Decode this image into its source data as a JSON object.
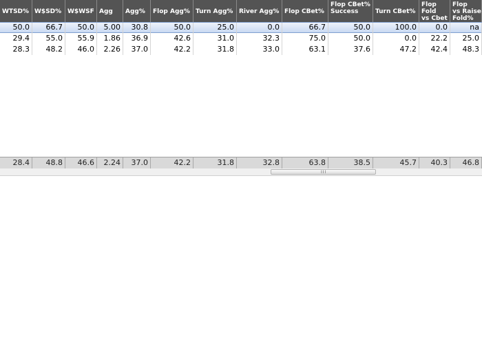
{
  "headers": [
    "WTSD%",
    "W$SD%",
    "W$WSF",
    "Agg",
    "Agg%",
    "Flop Agg%",
    "Turn Agg%",
    "River Agg%",
    "Flop CBet%",
    "Flop CBet%\nSuccess",
    "Turn CBet%",
    "Flop\nFold\nvs Cbet",
    "Flop\nvs Raise\nFold%"
  ],
  "rows": [
    [
      "50.0",
      "66.7",
      "50.0",
      "5.00",
      "30.8",
      "50.0",
      "25.0",
      "0.0",
      "66.7",
      "50.0",
      "100.0",
      "0.0",
      "na"
    ],
    [
      "29.4",
      "55.0",
      "55.9",
      "1.86",
      "36.9",
      "42.6",
      "31.0",
      "32.3",
      "75.0",
      "50.0",
      "0.0",
      "22.2",
      "25.0"
    ],
    [
      "28.3",
      "48.2",
      "46.0",
      "2.26",
      "37.0",
      "42.2",
      "31.8",
      "33.0",
      "63.1",
      "37.6",
      "47.2",
      "42.4",
      "48.3"
    ]
  ],
  "totals": [
    "28.4",
    "48.8",
    "46.6",
    "2.24",
    "37.0",
    "42.2",
    "31.8",
    "32.8",
    "63.8",
    "38.5",
    "45.7",
    "40.3",
    "46.8"
  ],
  "scrollbar": {
    "grip": "III"
  },
  "colors": {
    "header_bg": "#545454",
    "selected_row": "#c9d9f2",
    "totals_bg": "#d9d9d9"
  }
}
